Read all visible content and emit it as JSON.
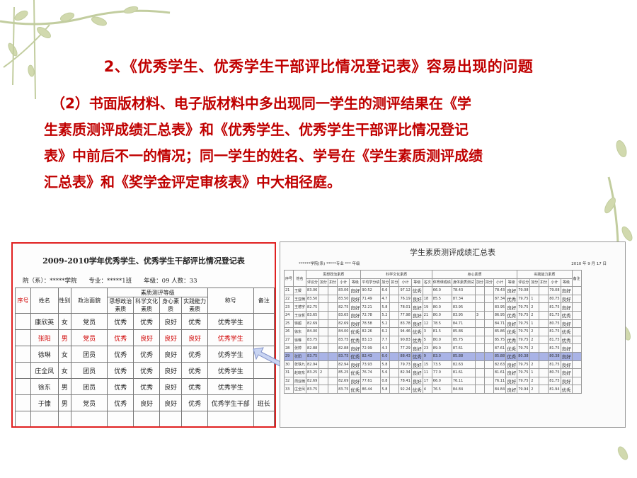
{
  "slide": {
    "title": "2、《优秀学生、优秀学生干部评比情况登记表》容易出现的问题",
    "paragraph_lines": [
      "（2）书面版材料、电子版材料中多出现同一学生的测评结果在《学",
      "生素质测评成绩汇总表》和《优秀学生、优秀学生干部评比情况登记",
      "表》中前后不一的情况；同一学生的姓名、学号在《学生素质测评成绩",
      "汇总表》和《奖学金评定审核表》中大相径庭。"
    ],
    "colors": {
      "accent_red": "#c00000",
      "highlight_blue": "#a9b3e6",
      "decor_green": "#b8c48e"
    }
  },
  "left_table": {
    "title": "2009-2010学年优秀学生、优秀学生干部评比情况登记表",
    "meta": "院（系）：*****学院　　专业：*****1班　　年级：09 人数：33",
    "header_top": "素质测评等级",
    "headers": [
      "序号",
      "姓名",
      "性别",
      "政治面貌",
      "思想政治素质",
      "科学文化素质",
      "身心素质",
      "实践能力素质",
      "称号",
      "备注"
    ],
    "rows": [
      [
        "",
        "康欣英",
        "女",
        "党员",
        "优秀",
        "优秀",
        "良好",
        "优秀",
        "优秀学生",
        ""
      ],
      [
        "",
        "张阳",
        "男",
        "党员",
        "优秀",
        "良好",
        "良好",
        "良好",
        "优秀学生",
        ""
      ],
      [
        "",
        "徐琳",
        "女",
        "团员",
        "优秀",
        "优秀",
        "良好",
        "优秀",
        "优秀学生",
        ""
      ],
      [
        "",
        "庄全凤",
        "女",
        "团员",
        "优秀",
        "优秀",
        "良好",
        "优秀",
        "优秀学生",
        ""
      ],
      [
        "",
        "徐东",
        "男",
        "团员",
        "优秀",
        "优秀",
        "良好",
        "优秀",
        "优秀学生",
        ""
      ],
      [
        "",
        "于慷",
        "男",
        "党员",
        "优秀",
        "良好",
        "良好",
        "优秀",
        "优秀学生干部",
        "班长"
      ],
      [
        "",
        "",
        "",
        "",
        "",
        "",
        "",
        "",
        "",
        ""
      ],
      [
        "",
        "",
        "",
        "",
        "",
        "",
        "",
        "",
        "",
        ""
      ]
    ]
  },
  "right_table": {
    "title": "学生素质测评成绩汇总表",
    "meta_left": "******学院(系) *****专业 *** 年级",
    "meta_right": "2010 年 9 月 17 日",
    "groups": [
      "思想政治素质",
      "科学文化素质",
      "身心素质",
      "实践能力素质"
    ],
    "headers": [
      "序号",
      "姓名",
      "评议分",
      "加分",
      "扣分",
      "小计",
      "等级",
      "平均学分绩",
      "加分",
      "扣分",
      "小计",
      "等级",
      "名次",
      "体育课成绩",
      "身体素质测试",
      "加分",
      "扣分",
      "小计",
      "等级",
      "评议分",
      "加分",
      "扣分",
      "小计",
      "等级",
      "备注"
    ],
    "rows": [
      [
        "21",
        "王媛",
        "83.06",
        "",
        "",
        "83.06",
        "良好",
        "90.52",
        "6.6",
        "",
        "97.12",
        "优秀",
        "",
        "66.0",
        "78.43",
        "",
        "",
        "78.43",
        "良好",
        "79.08",
        "",
        "",
        "79.08",
        "良好",
        ""
      ],
      [
        "22",
        "王亚楠",
        "83.50",
        "",
        "",
        "83.50",
        "良好",
        "71.49",
        "4.7",
        "",
        "76.19",
        "良好",
        "18",
        "85.5",
        "87.34",
        "",
        "",
        "87.34",
        "优秀",
        "79.75",
        "1",
        "",
        "80.75",
        "良好",
        ""
      ],
      [
        "23",
        "王德宇",
        "82.75",
        "",
        "",
        "82.75",
        "良好",
        "72.21",
        "5.8",
        "",
        "78.01",
        "良好",
        "19",
        "80.0",
        "83.95",
        "",
        "",
        "83.95",
        "良好",
        "79.75",
        "2",
        "",
        "81.75",
        "良好",
        ""
      ],
      [
        "24",
        "王亚哲",
        "83.65",
        "",
        "",
        "83.65",
        "良好",
        "72.78",
        "5.2",
        "",
        "77.98",
        "良好",
        "21",
        "80.0",
        "83.95",
        "3",
        "",
        "86.95",
        "优秀",
        "79.75",
        "2",
        "",
        "81.75",
        "优秀",
        ""
      ],
      [
        "25",
        "徐超",
        "82.69",
        "",
        "",
        "82.69",
        "良好",
        "78.58",
        "5.2",
        "",
        "83.78",
        "良好",
        "12",
        "78.5",
        "84.71",
        "",
        "",
        "84.71",
        "良好",
        "79.75",
        "1",
        "",
        "80.75",
        "良好",
        ""
      ],
      [
        "26",
        "徐东",
        "84.00",
        "",
        "",
        "84.00",
        "优秀",
        "82.26",
        "6.2",
        "",
        "94.46",
        "优秀",
        "3",
        "81.5",
        "85.86",
        "",
        "",
        "85.86",
        "优秀",
        "79.75",
        "2",
        "",
        "81.75",
        "优秀",
        ""
      ],
      [
        "27",
        "徐琳",
        "83.75",
        "",
        "",
        "83.75",
        "优秀",
        "83.13",
        "7.7",
        "",
        "90.83",
        "优秀",
        "5",
        "80.0",
        "85.75",
        "",
        "",
        "85.75",
        "优秀",
        "79.75",
        "2",
        "",
        "81.75",
        "优秀",
        ""
      ],
      [
        "28",
        "张婷",
        "82.88",
        "",
        "",
        "82.88",
        "良好",
        "72.99",
        "4.3",
        "",
        "77.29",
        "良好",
        "23",
        "89.0",
        "87.61",
        "",
        "",
        "87.61",
        "优秀",
        "79.75",
        "2",
        "",
        "81.75",
        "良好",
        ""
      ],
      [
        "29",
        "张阳",
        "83.75",
        "",
        "",
        "83.75",
        "优秀",
        "82.43",
        "6.0",
        "",
        "88.43",
        "优秀",
        "9",
        "83.0",
        "85.88",
        "",
        "",
        "85.88",
        "优秀",
        "80.38",
        "",
        "",
        "80.38",
        "良好",
        ""
      ],
      [
        "30",
        "张铁九",
        "82.94",
        "",
        "",
        "82.94",
        "良好",
        "73.93",
        "5.8",
        "",
        "79.73",
        "良好",
        "15",
        "73.5",
        "82.63",
        "",
        "",
        "82.63",
        "良好",
        "79.75",
        "2",
        "",
        "81.75",
        "良好",
        ""
      ],
      [
        "31",
        "赵晓东",
        "83.25",
        "2",
        "",
        "85.25",
        "优秀",
        "76.74",
        "5.6",
        "",
        "82.34",
        "良好",
        "11",
        "77.0",
        "81.61",
        "",
        "",
        "81.61",
        "良好",
        "79.75",
        "1",
        "",
        "80.75",
        "良好",
        ""
      ],
      [
        "32",
        "周亚楠",
        "82.69",
        "",
        "",
        "82.69",
        "良好",
        "77.61",
        "0.8",
        "",
        "78.41",
        "良好",
        "17",
        "66.0",
        "76.11",
        "",
        "",
        "76.11",
        "良好",
        "79.75",
        "2",
        "",
        "81.75",
        "良好",
        ""
      ],
      [
        "33",
        "庄全凤",
        "83.75",
        "",
        "",
        "83.75",
        "优秀",
        "86.44",
        "5.8",
        "",
        "92.24",
        "优秀",
        "4",
        "76.5",
        "84.84",
        "",
        "",
        "84.84",
        "良好",
        "79.94",
        "2",
        "",
        "81.94",
        "优秀",
        ""
      ]
    ]
  }
}
